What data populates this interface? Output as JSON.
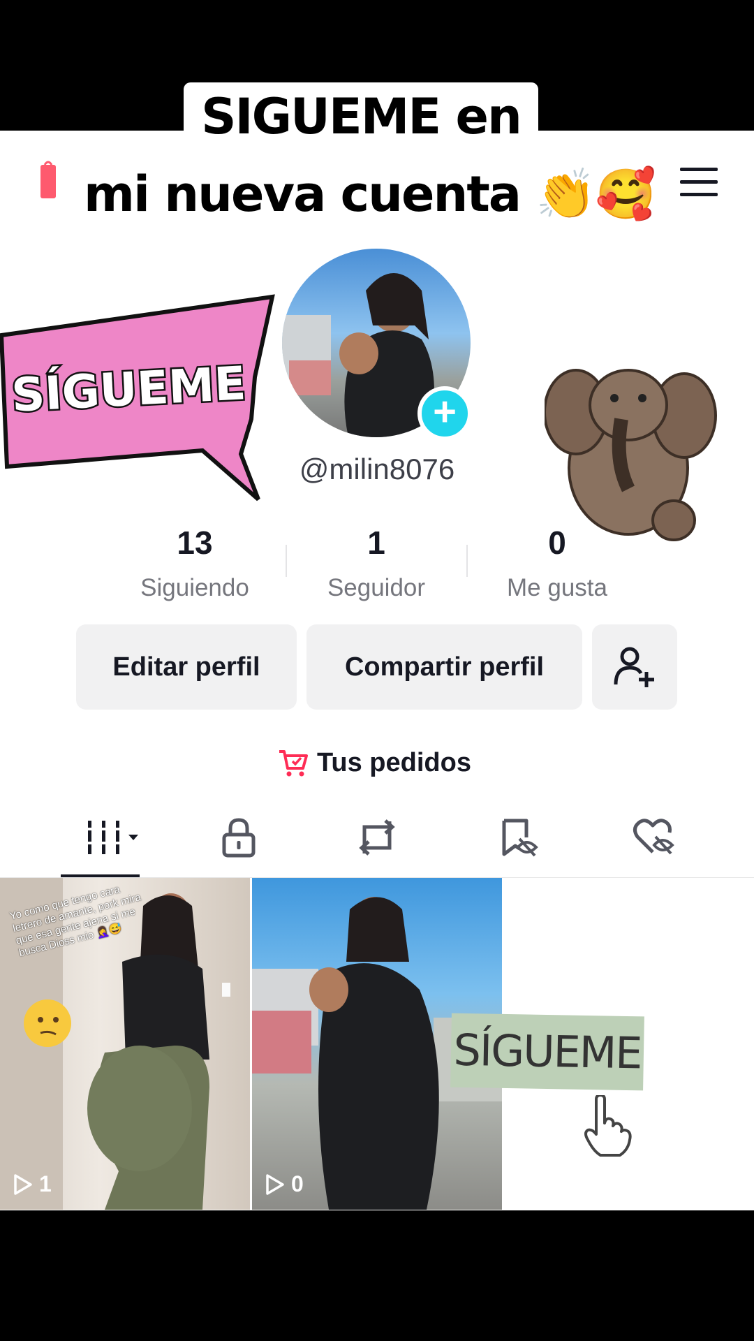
{
  "caption": {
    "line1": "SIGUEME en",
    "line2": "mi nueva cuenta 👏🥰"
  },
  "profile": {
    "username": "@milin8076",
    "sticker_left_text": "SÍGUEME"
  },
  "stats": [
    {
      "value": "13",
      "label": "Siguiendo"
    },
    {
      "value": "1",
      "label": "Seguidor"
    },
    {
      "value": "0",
      "label": "Me gusta"
    }
  ],
  "buttons": {
    "edit": "Editar perfil",
    "share": "Compartir perfil"
  },
  "orders": {
    "label": "Tus pedidos"
  },
  "tabs": [
    "videos-grid-icon",
    "lock-icon",
    "repost-icon",
    "saved-hidden-icon",
    "liked-hidden-icon"
  ],
  "videos": [
    {
      "overlay_text": "Yo como que tengo cara letrero de amante, pork mira que esa gente ajena si me busca Dioss mio 🤦‍♀️😅",
      "plays": "1"
    },
    {
      "plays": "0"
    },
    {
      "overlay_text": "SÍGUEME"
    }
  ],
  "colors": {
    "accent": "#20d5ec",
    "brand": "#fe2c55"
  }
}
